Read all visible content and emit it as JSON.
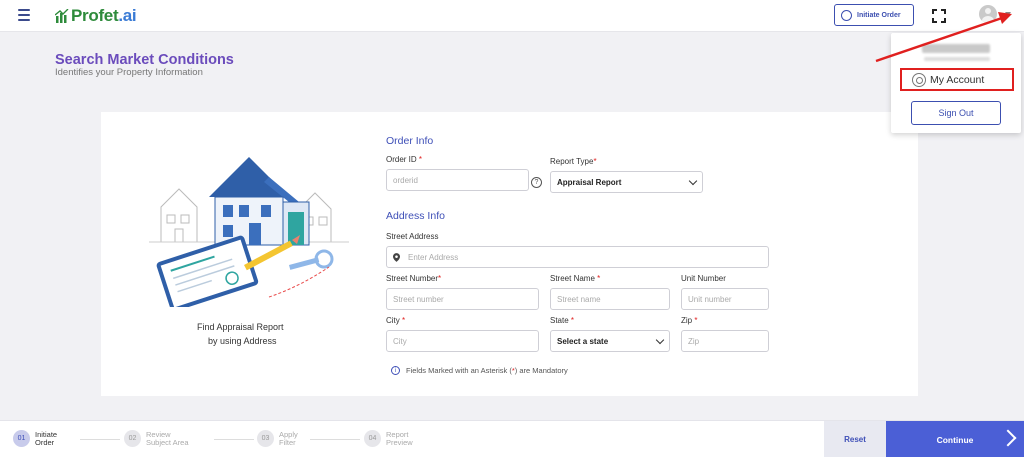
{
  "header": {
    "logo_main": "Profet",
    "logo_suffix": ".ai",
    "initiate_order_label": "Initiate Order"
  },
  "user_menu": {
    "my_account_label": "My Account",
    "sign_out_label": "Sign Out"
  },
  "page": {
    "title": "Search Market Conditions",
    "subtitle": "Identifies your Property Information"
  },
  "illustration": {
    "caption_line1": "Find Appraisal Report",
    "caption_line2": "by using Address"
  },
  "order_info": {
    "section_title": "Order Info",
    "order_id_label": "Order ID",
    "order_id_placeholder": "orderid",
    "report_type_label": "Report Type",
    "report_type_value": "Appraisal Report"
  },
  "address_info": {
    "section_title": "Address Info",
    "street_address_label": "Street Address",
    "street_address_placeholder": "Enter Address",
    "street_number_label": "Street Number",
    "street_number_placeholder": "Street number",
    "street_name_label": "Street Name",
    "street_name_placeholder": "Street name",
    "unit_number_label": "Unit Number",
    "unit_number_placeholder": "Unit number",
    "city_label": "City",
    "city_placeholder": "City",
    "state_label": "State",
    "state_value": "Select a state",
    "zip_label": "Zip",
    "zip_placeholder": "Zip",
    "asterisk": "*"
  },
  "notice": {
    "before": "Fields Marked with an Asterisk (",
    "star": " * ",
    "after": ") are Mandatory"
  },
  "steps": [
    {
      "num": "01",
      "line1": "Initiate",
      "line2": "Order"
    },
    {
      "num": "02",
      "line1": "Review",
      "line2": "Subject Area"
    },
    {
      "num": "03",
      "line1": "Apply",
      "line2": "Filter"
    },
    {
      "num": "04",
      "line1": "Report",
      "line2": "Preview"
    }
  ],
  "footer": {
    "reset_label": "Reset",
    "continue_label": "Continue"
  },
  "colors": {
    "brand_green": "#2e8b3b",
    "accent_blue": "#4b5fd6",
    "title_purple": "#6b4cbc",
    "highlight_red": "#e0201f"
  }
}
